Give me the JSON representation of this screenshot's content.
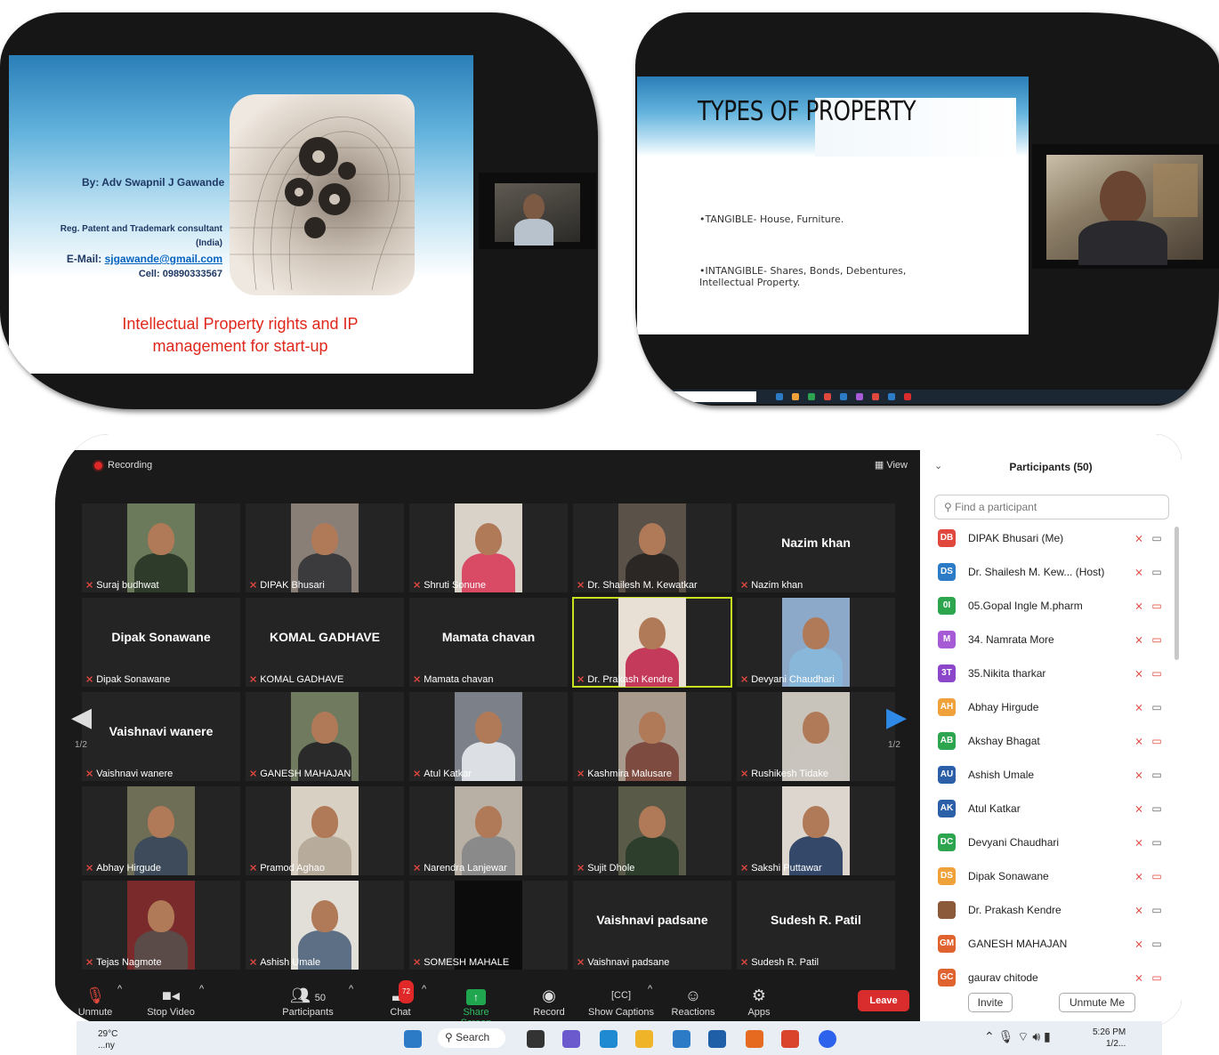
{
  "slide1": {
    "by": "By: Adv Swapnil J Gawande",
    "role_line1": "Reg. Patent and Trademark consultant",
    "role_line2": "(India)",
    "email_prefix": "E-Mail: ",
    "email": "sjgawande@gmail.com",
    "cell": "Cell: 09890333567",
    "title_line1": "Intellectual Property rights and IP",
    "title_line2": "management for start-up"
  },
  "slide2": {
    "title": "TYPES OF PROPERTY",
    "line1": "•TANGIBLE- House, Furniture.",
    "line2a": "•INTANGIBLE- Shares, Bonds, Debentures,",
    "line2b": "Intellectual Property."
  },
  "zoom": {
    "recording": "Recording",
    "view": "View",
    "page_left": "1/2",
    "page_right": "1/2",
    "tiles": [
      {
        "name": "Suraj budhwat",
        "video": true
      },
      {
        "name": "DIPAK Bhusari",
        "video": true
      },
      {
        "name": "Shruti Sonune",
        "video": true
      },
      {
        "name": "Dr. Shailesh M. Kewatkar",
        "video": true
      },
      {
        "name": "Nazim khan",
        "big": "Nazim khan"
      },
      {
        "name": "Dipak Sonawane",
        "big": "Dipak Sonawane"
      },
      {
        "name": "KOMAL GADHAVE",
        "big": "KOMAL GADHAVE"
      },
      {
        "name": "Mamata chavan",
        "big": "Mamata chavan"
      },
      {
        "name": "Dr. Prakash Kendre",
        "video": true
      },
      {
        "name": "Devyani Chaudhari",
        "video": true
      },
      {
        "name": "Vaishnavi wanere",
        "big": "Vaishnavi wanere"
      },
      {
        "name": "GANESH MAHAJAN",
        "video": true
      },
      {
        "name": "Atul Katkar",
        "video": true
      },
      {
        "name": "Kashmira Malusare",
        "video": true
      },
      {
        "name": "Rushikesh Tidake",
        "video": true
      },
      {
        "name": "Abhay Hirgude",
        "video": true
      },
      {
        "name": "Pramod Aghao",
        "video": true
      },
      {
        "name": "Narendra Lanjewar",
        "video": true
      },
      {
        "name": "Sujit Dhole",
        "video": true
      },
      {
        "name": "Sakshi Puttawar",
        "video": true
      },
      {
        "name": "Tejas Nagmote",
        "video": true
      },
      {
        "name": "Ashish  Umale",
        "video": true
      },
      {
        "name": "SOMESH MAHALE",
        "video": true
      },
      {
        "name": "Vaishnavi padsane",
        "big": "Vaishnavi padsane"
      },
      {
        "name": "Sudesh R. Patil",
        "big": "Sudesh R. Patil"
      }
    ],
    "toolbar": {
      "unmute": "Unmute",
      "stop_video": "Stop Video",
      "participants": "Participants",
      "participants_count": "50",
      "chat": "Chat",
      "chat_badge": "72",
      "share": "Share Screen",
      "record": "Record",
      "captions": "Show Captions",
      "reactions": "Reactions",
      "apps": "Apps",
      "leave": "Leave"
    }
  },
  "panel": {
    "header": "Participants (50)",
    "search_placeholder": "Find a participant",
    "rows": [
      {
        "initials": "DB",
        "color": "#e0483e",
        "name": "DIPAK Bhusari (Me)",
        "cam_off": false
      },
      {
        "initials": "DS",
        "color": "#2b7bc7",
        "name": "Dr. Shailesh M. Kew... (Host)",
        "cam_off": false
      },
      {
        "initials": "0I",
        "color": "#2da44e",
        "name": "05.Gopal Ingle M.pharm",
        "cam_off": true
      },
      {
        "initials": "M",
        "color": "#a75ad6",
        "name": "34. Namrata More",
        "cam_off": true
      },
      {
        "initials": "3T",
        "color": "#8b46c9",
        "name": "35.Nikita tharkar",
        "cam_off": true
      },
      {
        "initials": "AH",
        "color": "#f0a23a",
        "name": "Abhay Hirgude",
        "cam_off": false
      },
      {
        "initials": "AB",
        "color": "#2da44e",
        "name": "Akshay Bhagat",
        "cam_off": true
      },
      {
        "initials": "AU",
        "color": "#2b5fa8",
        "name": "Ashish  Umale",
        "cam_off": false
      },
      {
        "initials": "AK",
        "color": "#2b5fa8",
        "name": "Atul Katkar",
        "cam_off": false
      },
      {
        "initials": "DC",
        "color": "#2da44e",
        "name": "Devyani Chaudhari",
        "cam_off": false
      },
      {
        "initials": "DS",
        "color": "#f0a23a",
        "name": "Dipak Sonawane",
        "cam_off": true
      },
      {
        "initials": "",
        "color": "#8a5a3a",
        "name": "Dr. Prakash Kendre",
        "cam_off": false
      },
      {
        "initials": "GM",
        "color": "#e0622e",
        "name": "GANESH MAHAJAN",
        "cam_off": false
      },
      {
        "initials": "GC",
        "color": "#e0622e",
        "name": "gaurav chitode",
        "cam_off": true
      }
    ],
    "invite": "Invite",
    "unmute_me": "Unmute Me"
  },
  "taskbar": {
    "temp": "29°C",
    "weather": "...ny",
    "search": "Search",
    "time": "5:26 PM",
    "date": "1/2..."
  }
}
